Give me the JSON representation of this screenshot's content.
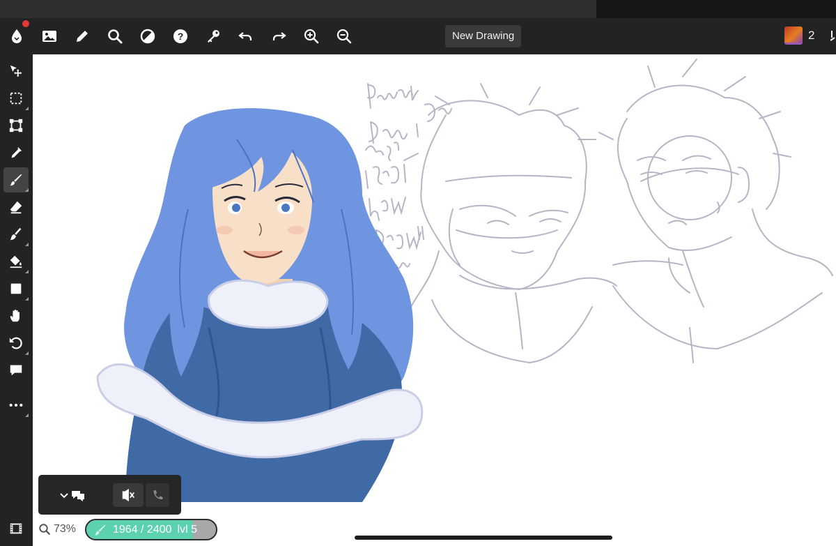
{
  "document": {
    "title": "New Drawing"
  },
  "topbar": {
    "buttons": [
      {
        "name": "app-logo-icon",
        "icon": "drop-logo"
      },
      {
        "name": "gallery-icon",
        "icon": "image"
      },
      {
        "name": "pencil-icon",
        "icon": "edit"
      },
      {
        "name": "search-icon",
        "icon": "magnifier"
      },
      {
        "name": "adjust-icon",
        "icon": "contrast"
      },
      {
        "name": "help-icon",
        "icon": "question"
      },
      {
        "name": "key-icon",
        "icon": "key"
      },
      {
        "name": "undo-icon",
        "icon": "undo"
      },
      {
        "name": "redo-icon",
        "icon": "redo"
      },
      {
        "name": "zoom-in-icon",
        "icon": "zoom-in"
      },
      {
        "name": "zoom-out-icon",
        "icon": "zoom-out"
      }
    ],
    "notification_color": "#e53935"
  },
  "users": {
    "count": "2"
  },
  "tools": [
    {
      "name": "move-tool",
      "icon": "move"
    },
    {
      "name": "select-tool",
      "icon": "selection"
    },
    {
      "name": "transform-tool",
      "icon": "transform"
    },
    {
      "name": "eyedropper-tool",
      "icon": "eyedropper"
    },
    {
      "name": "brush-tool",
      "icon": "brush",
      "active": true
    },
    {
      "name": "eraser-tool",
      "icon": "eraser"
    },
    {
      "name": "smudge-tool",
      "icon": "smudge"
    },
    {
      "name": "fill-tool",
      "icon": "bucket"
    },
    {
      "name": "shape-tool",
      "icon": "square"
    },
    {
      "name": "hand-tool",
      "icon": "hand"
    },
    {
      "name": "rotate-tool",
      "icon": "rotate"
    },
    {
      "name": "comment-tool",
      "icon": "speech-bubble"
    },
    {
      "name": "more-tools",
      "icon": "dots"
    }
  ],
  "canvas": {
    "sketch_note": "Practicing Drawing Gray Cause I forgot how to draw him!!",
    "colors": {
      "hair": "#6f95e0",
      "cape": "#3f6aa6",
      "fur": "#eef0fa",
      "skin": "#f8e0c8",
      "sketch": "#b7b4c6"
    }
  },
  "bottom": {
    "zoom": "73%",
    "stats": "1964 / 2400",
    "level": "lvl 5",
    "progress": 0.82
  },
  "colors": {
    "accent": "#5cd1b0",
    "bar": "#232323"
  }
}
